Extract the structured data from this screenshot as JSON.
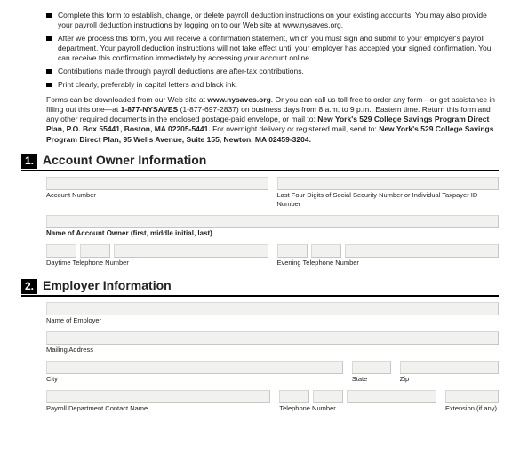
{
  "bullets": [
    "Complete this form to establish, change, or delete payroll deduction instructions on your existing accounts. You may also provide your payroll deduction instructions by logging on to our Web site at www.nysaves.org.",
    "After we process this form, you will receive a confirmation statement, which you must sign and submit to your employer's payroll department. Your payroll deduction instructions will not take effect until your employer has accepted your signed confirmation. You can receive this confirmation immediately by accessing your account online.",
    "Contributions made through payroll deductions are after-tax contributions.",
    "Print clearly, preferably in capital letters and black ink."
  ],
  "paragraph": {
    "p1a": "Forms can be downloaded from our Web site at ",
    "p1b": "www.nysaves.org",
    "p1c": ". Or you can call us toll-free to order any form—or get assistance in filling out this one—at ",
    "p1d": "1-877-NYSAVES",
    "p1e": " (1-877-697-2837) on business days from 8 a.m. to 9 p.m., Eastern time. Return this form and any other required documents in the enclosed postage-paid envelope, or mail to: ",
    "p1f": "New York's 529 College Savings Program Direct Plan, P.O. Box 55441, Boston, MA 02205-5441.",
    "p1g": " For overnight delivery or registered mail, send to: ",
    "p1h": "New York's 529 College Savings Program Direct Plan, 95 Wells Avenue, Suite 155, Newton, MA 02459-3204."
  },
  "section1": {
    "num": "1.",
    "title": "Account Owner Information",
    "labels": {
      "account_number": "Account Number",
      "ssn": "Last Four Digits of Social Security Number or Individual Taxpayer ID Number",
      "owner_name": "Name of Account Owner (first, middle initial, last)",
      "day_phone": "Daytime Telephone Number",
      "eve_phone": "Evening Telephone Number"
    }
  },
  "section2": {
    "num": "2.",
    "title": "Employer Information",
    "labels": {
      "employer": "Name of Employer",
      "mailing": "Mailing Address",
      "city": "City",
      "state": "State",
      "zip": "Zip",
      "payroll_contact": "Payroll Department Contact Name",
      "phone": "Telephone Number",
      "ext": "Extension (if any)"
    }
  }
}
